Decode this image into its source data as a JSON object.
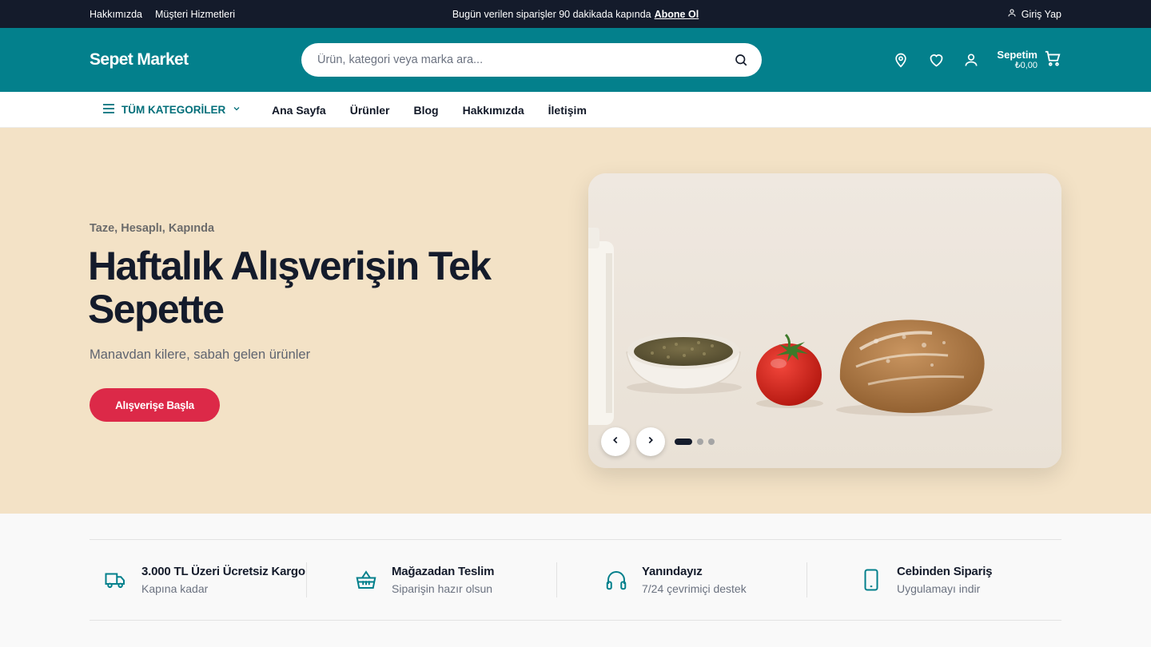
{
  "topbar": {
    "links": [
      "Hakkımızda",
      "Müşteri Hizmetleri"
    ],
    "announcement": "Bugün verilen siparişler 90 dakikada kapında",
    "announcement_link": "Abone Ol",
    "login": "Giriş Yap"
  },
  "header": {
    "logo": "Sepet Market",
    "search_placeholder": "Ürün, kategori veya marka ara...",
    "cart_label": "Sepetim",
    "cart_total": "₺0,00",
    "icons": [
      "location-pin-icon",
      "heart-icon",
      "user-icon",
      "cart-icon"
    ]
  },
  "nav": {
    "categories": "TÜM KATEGORİLER",
    "links": [
      "Ana Sayfa",
      "Ürünler",
      "Blog",
      "Hakkımızda",
      "İletişim"
    ]
  },
  "hero": {
    "eyebrow": "Taze, Hesaplı, Kapında",
    "title": "Haftalık Alışverişin Tek Sepette",
    "subtitle": "Manavdan kilere, sabah gelen ürünler",
    "cta": "Alışverişe Başla",
    "slider": {
      "slides": 3,
      "active": 1
    }
  },
  "features": [
    {
      "icon": "truck-icon",
      "title": "3.000 TL Üzeri Ücretsiz Kargo",
      "desc": "Kapına kadar"
    },
    {
      "icon": "basket-icon",
      "title": "Mağazadan Teslim",
      "desc": "Siparişin hazır olsun"
    },
    {
      "icon": "headphones-icon",
      "title": "Yanındayız",
      "desc": "7/24 çevrimiçi destek"
    },
    {
      "icon": "phone-icon",
      "title": "Cebinden Sipariş",
      "desc": "Uygulamayı indir"
    }
  ],
  "colors": {
    "topbar": "#141b2b",
    "brand_teal": "#03808c",
    "hero_bg": "#f3e2c6",
    "cta_red": "#dc2948"
  }
}
